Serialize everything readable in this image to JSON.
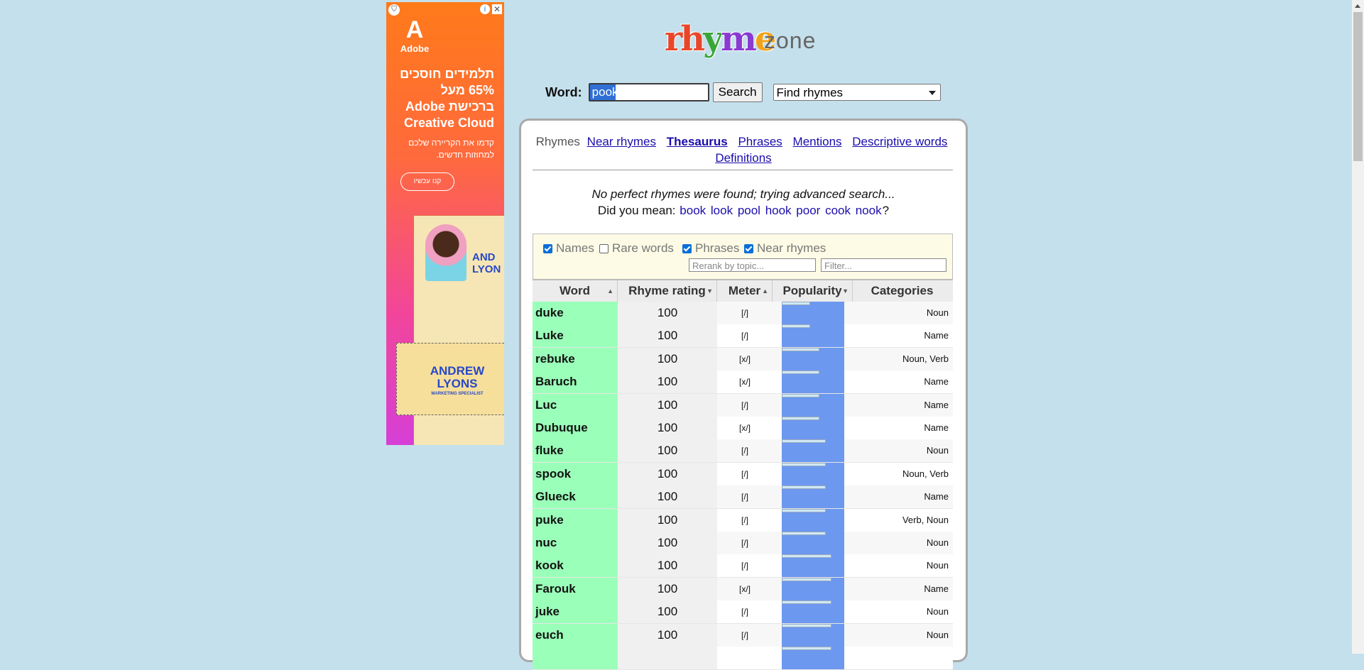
{
  "ad": {
    "brand": "Adobe",
    "headline": "תלמידים חוסכים 65% מעל ברכישת Adobe Creative Cloud",
    "subtext": "קדמו את הקריירה שלכם למחוזות חדשים.",
    "cta": "קנו עכשיו",
    "card_name": "AND LYON",
    "card2_name": "ANDREW LYONS",
    "card2_sub": "MARKETING SPECIALIST",
    "info_icon": "i",
    "close_icon": "✕"
  },
  "logo": {
    "rhyme": "rhyme",
    "zone": "zone"
  },
  "search": {
    "label": "Word:",
    "value": "pook",
    "button": "Search",
    "mode": "Find rhymes"
  },
  "nav": {
    "items": [
      {
        "label": "Rhymes",
        "current": true
      },
      {
        "label": "Near rhymes"
      },
      {
        "label": "Thesaurus",
        "bold": true
      },
      {
        "label": "Phrases"
      },
      {
        "label": "Mentions"
      },
      {
        "label": "Descriptive words"
      },
      {
        "label": "Definitions"
      }
    ]
  },
  "message": {
    "line1": "No perfect rhymes were found; trying advanced search...",
    "did_you_mean": "Did you mean:",
    "suggestions": [
      "book",
      "look",
      "pool",
      "hook",
      "poor",
      "cook",
      "nook"
    ],
    "end": "?"
  },
  "filters": {
    "names": "Names",
    "rare": "Rare words",
    "phrases": "Phrases",
    "near": "Near rhymes",
    "rerank_placeholder": "Rerank by topic...",
    "filter_placeholder": "Filter..."
  },
  "table": {
    "headers": {
      "word": "Word",
      "rating": "Rhyme rating",
      "meter": "Meter",
      "popularity": "Popularity",
      "categories": "Categories"
    },
    "rows": [
      {
        "word": "duke",
        "rating": "100",
        "meter": "[/]",
        "pop": 0.45,
        "cat": "Noun"
      },
      {
        "word": "Luke",
        "rating": "100",
        "meter": "[/]",
        "pop": 0.45,
        "cat": "Name"
      },
      {
        "word": "rebuke",
        "rating": "100",
        "meter": "[x/]",
        "pop": 0.6,
        "cat": "Noun, Verb"
      },
      {
        "word": "Baruch",
        "rating": "100",
        "meter": "[x/]",
        "pop": 0.6,
        "cat": "Name"
      },
      {
        "word": "Luc",
        "rating": "100",
        "meter": "[/]",
        "pop": 0.6,
        "cat": "Name"
      },
      {
        "word": "Dubuque",
        "rating": "100",
        "meter": "[x/]",
        "pop": 0.6,
        "cat": "Name"
      },
      {
        "word": "fluke",
        "rating": "100",
        "meter": "[/]",
        "pop": 0.7,
        "cat": "Noun"
      },
      {
        "word": "spook",
        "rating": "100",
        "meter": "[/]",
        "pop": 0.7,
        "cat": "Noun, Verb"
      },
      {
        "word": "Glueck",
        "rating": "100",
        "meter": "[/]",
        "pop": 0.7,
        "cat": "Name"
      },
      {
        "word": "puke",
        "rating": "100",
        "meter": "[/]",
        "pop": 0.7,
        "cat": "Verb, Noun"
      },
      {
        "word": "nuc",
        "rating": "100",
        "meter": "[/]",
        "pop": 0.7,
        "cat": "Noun"
      },
      {
        "word": "kook",
        "rating": "100",
        "meter": "[/]",
        "pop": 0.8,
        "cat": "Noun"
      },
      {
        "word": "Farouk",
        "rating": "100",
        "meter": "[x/]",
        "pop": 0.8,
        "cat": "Name"
      },
      {
        "word": "juke",
        "rating": "100",
        "meter": "[/]",
        "pop": 0.8,
        "cat": "Noun"
      },
      {
        "word": "euch",
        "rating": "100",
        "meter": "[/]",
        "pop": 0.8,
        "cat": "Noun"
      },
      {
        "word": "",
        "rating": "",
        "meter": "",
        "pop": 0.8,
        "cat": ""
      }
    ]
  }
}
